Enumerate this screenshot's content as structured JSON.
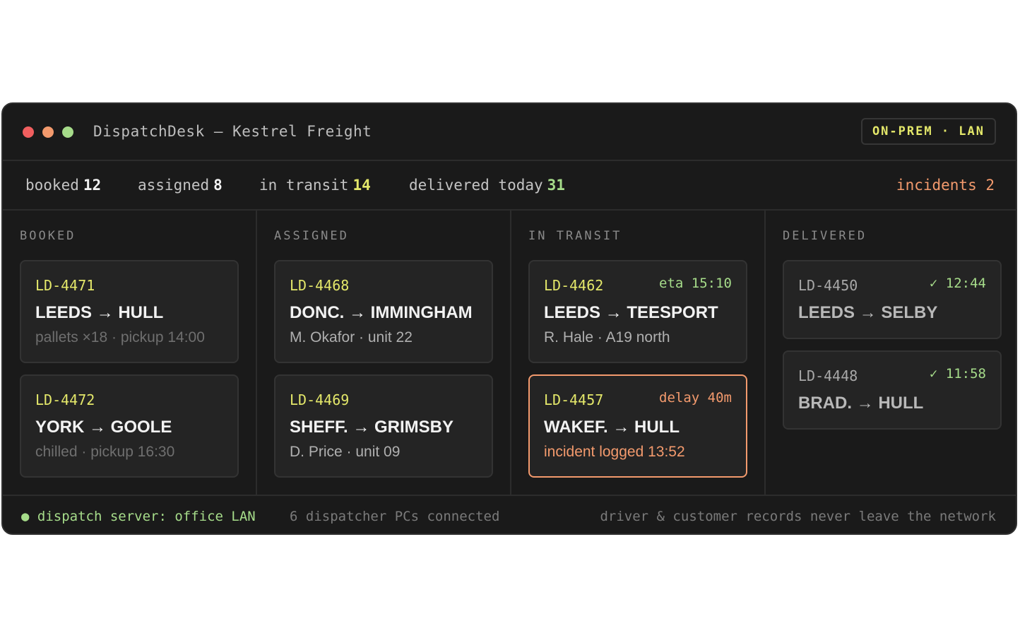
{
  "window": {
    "title": "DispatchDesk — Kestrel Freight",
    "badge": "ON-PREM · LAN"
  },
  "stats": {
    "booked": {
      "label": "booked",
      "value": "12"
    },
    "assigned": {
      "label": "assigned",
      "value": "8"
    },
    "in_transit": {
      "label": "in transit",
      "value": "14"
    },
    "delivered": {
      "label": "delivered today",
      "value": "31"
    },
    "incidents": "incidents 2"
  },
  "columns": [
    {
      "title": "BOOKED",
      "cards": [
        {
          "id": "LD-4471",
          "route": "LEEDS → HULL",
          "meta": "pallets ×18 · pickup 14:00"
        },
        {
          "id": "LD-4472",
          "route": "YORK → GOOLE",
          "meta": "chilled · pickup 16:30"
        }
      ]
    },
    {
      "title": "ASSIGNED",
      "cards": [
        {
          "id": "LD-4468",
          "route": "DONC. → IMMINGHAM",
          "meta": "M. Okafor · unit 22"
        },
        {
          "id": "LD-4469",
          "route": "SHEFF. → GRIMSBY",
          "meta": "D. Price · unit 09"
        }
      ]
    },
    {
      "title": "IN TRANSIT",
      "cards": [
        {
          "id": "LD-4462",
          "tag": "eta 15:10",
          "route": "LEEDS → TEESPORT",
          "meta": "R. Hale · A19 north"
        },
        {
          "id": "LD-4457",
          "tag": "delay 40m",
          "route": "WAKEF. → HULL",
          "meta": "incident logged 13:52"
        }
      ]
    },
    {
      "title": "DELIVERED",
      "cards": [
        {
          "id": "LD-4450",
          "tag": "✓ 12:44",
          "route": "LEEDS → SELBY"
        },
        {
          "id": "LD-4448",
          "tag": "✓ 11:58",
          "route": "BRAD. → HULL"
        }
      ]
    }
  ],
  "footer": {
    "server": "● dispatch server: office LAN",
    "pcs": "6 dispatcher PCs connected",
    "privacy": "driver & customer records never leave the network"
  },
  "colors": {
    "accent_yellow": "#e4e86a",
    "accent_green": "#a6dc8a",
    "accent_orange": "#f39a6d",
    "background": "#1a1a1a"
  }
}
